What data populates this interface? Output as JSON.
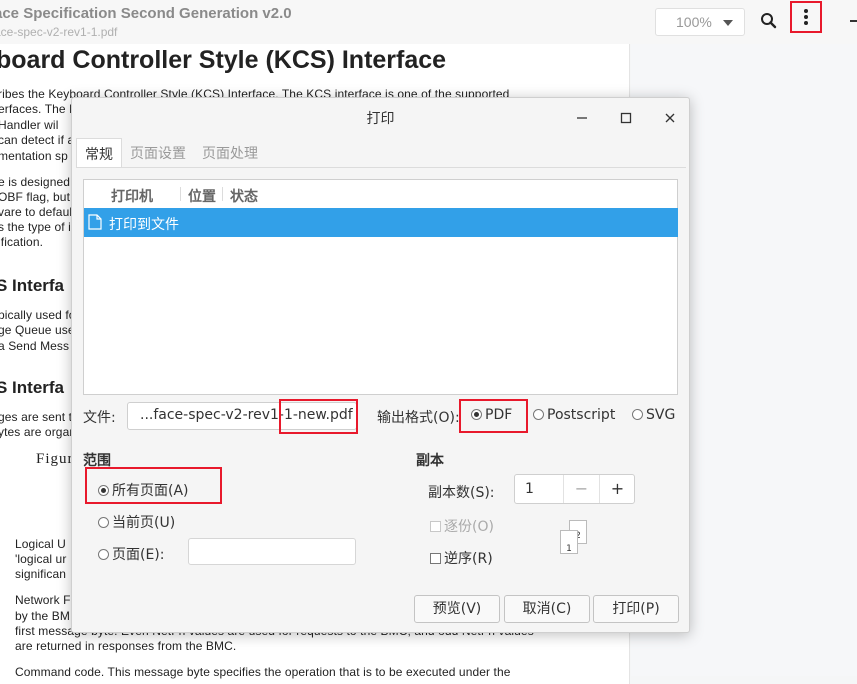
{
  "viewer": {
    "doc_title": "ace Specification Second Generation v2.0",
    "doc_filename": "ace-spec-v2-rev1-1.pdf",
    "zoom": "100%"
  },
  "document": {
    "heading": "board Controller Style (KCS) Interface",
    "para1": [
      "ribes the Keyboard Controller Style (KCS) Interface. The KCS interface is one of the supported",
      "erfaces. The K",
      " Handler wil",
      "can detect if a",
      "mentation sp"
    ],
    "para2": [
      "e is designed",
      "OBF flag, but",
      "vare to defaul",
      "s the type of i",
      "ification."
    ],
    "subhead1": "S Interfa",
    "para3": [
      "pically used fo",
      "ge Queue use",
      "a Send Mess"
    ],
    "subhead2": "S Interfa",
    "para4": [
      "ges are sent t",
      "ytes are organ"
    ],
    "figure": "Figur",
    "para5": [
      "Logical U",
      "'logical ur",
      "significan"
    ],
    "para6": [
      "Network F",
      "by the BM",
      "first message byte. Even NetFn values are used for requests to the BMC, and odd NetFn values",
      "are returned in responses from the BMC."
    ],
    "para7": "Command code. This message byte specifies the operation that is to be executed under the"
  },
  "dialog": {
    "title": "打印",
    "tabs": [
      "常规",
      "页面设置",
      "页面处理"
    ],
    "printer_columns": [
      "打印机",
      "位置",
      "状态"
    ],
    "printers": [
      "打印到文件"
    ],
    "file_label": "文件:",
    "file_value": "...face-spec-v2-rev1-1-new.pdf",
    "format_label": "输出格式(O):",
    "formats": [
      "PDF",
      "Postscript",
      "SVG"
    ],
    "range_title": "范围",
    "range_all": "所有页面(A)",
    "range_current": "当前页(U)",
    "range_pages": "页面(E):",
    "range_pages_value": "",
    "copies_title": "副本",
    "copies_label": "副本数(S):",
    "copies_value": "1",
    "collate": "逐份(O)",
    "reverse": "逆序(R)",
    "buttons": {
      "preview": "预览(V)",
      "cancel": "取消(C)",
      "print": "打印(P)"
    }
  },
  "colors": {
    "accent": "#32a0e8",
    "highlight": "#e8192c"
  }
}
